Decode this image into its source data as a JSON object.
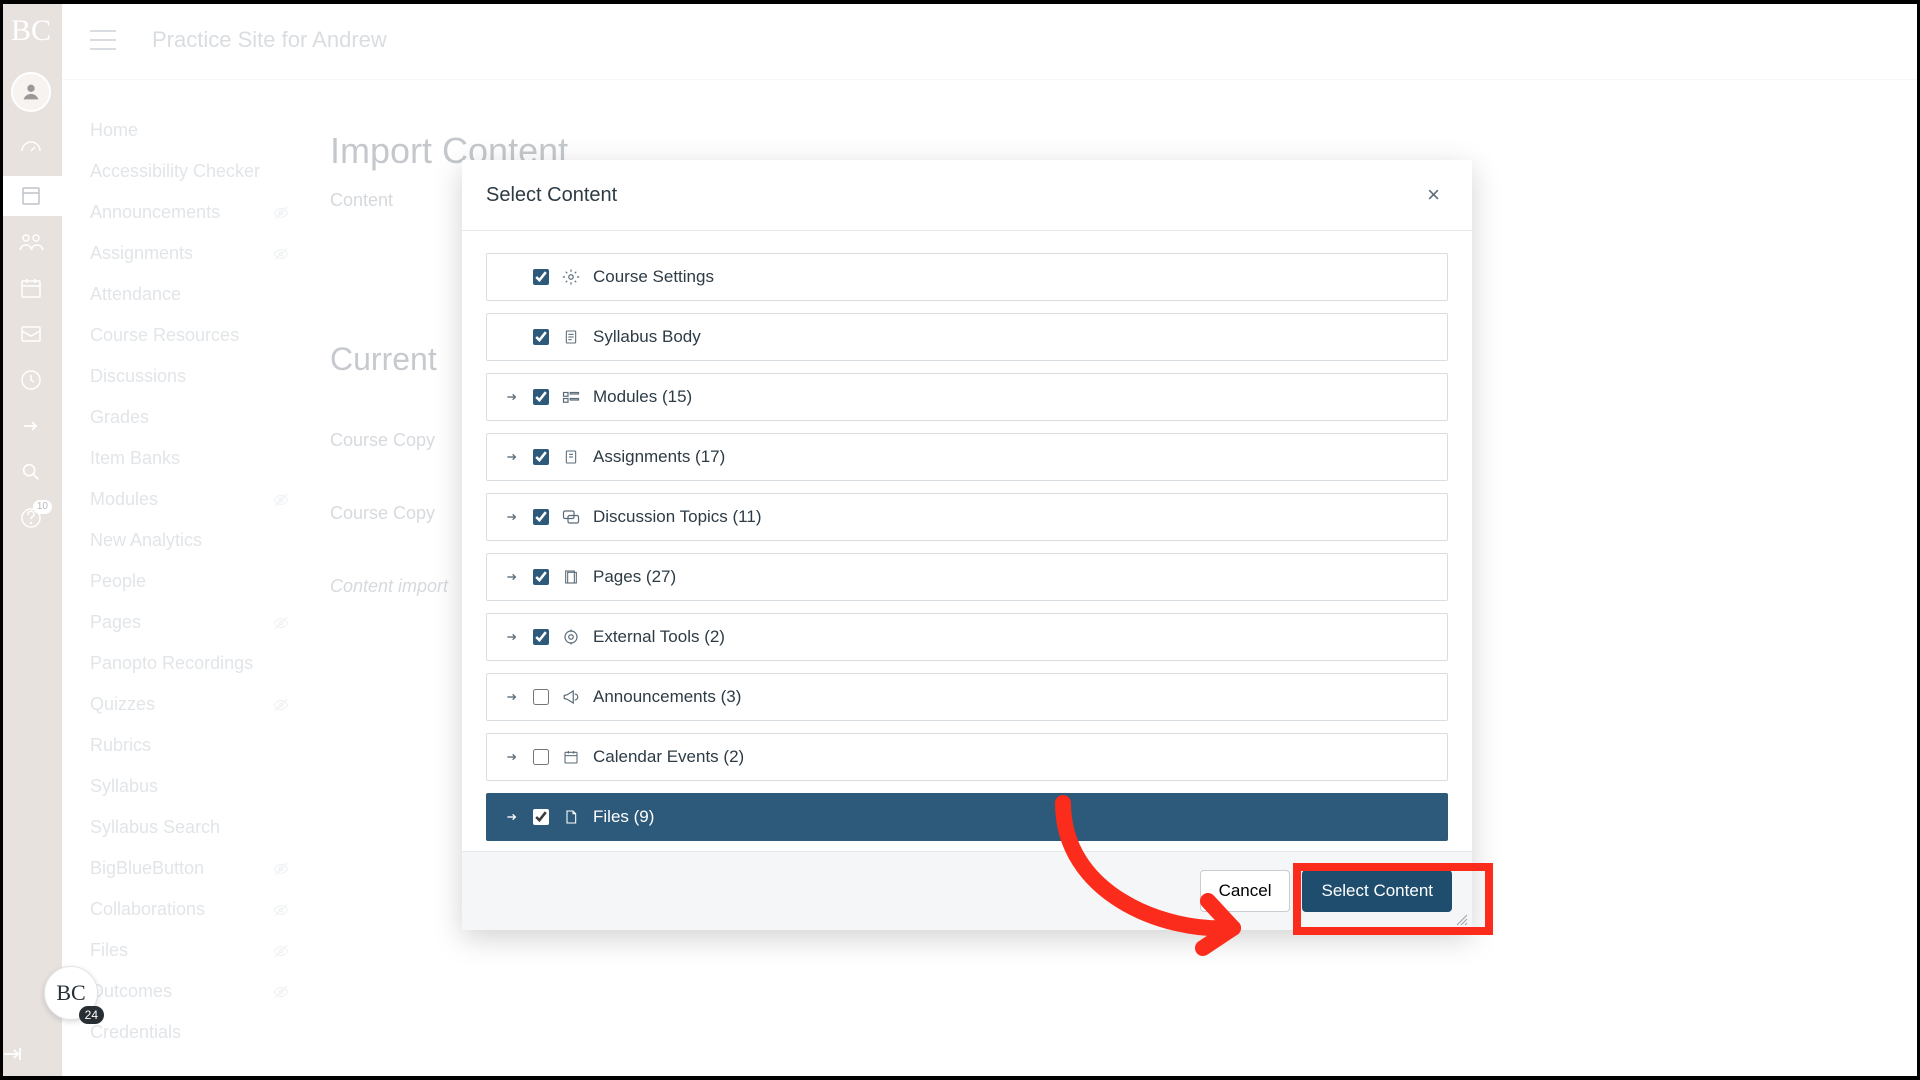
{
  "rail": {
    "logo": "BC",
    "help_badge": "10"
  },
  "topbar": {
    "breadcrumb": "Practice Site for Andrew"
  },
  "coursenav": [
    {
      "label": "Home",
      "hidden": false
    },
    {
      "label": "Accessibility Checker",
      "hidden": false
    },
    {
      "label": "Announcements",
      "hidden": true
    },
    {
      "label": "Assignments",
      "hidden": true
    },
    {
      "label": "Attendance",
      "hidden": false
    },
    {
      "label": "Course Resources",
      "hidden": false
    },
    {
      "label": "Discussions",
      "hidden": false
    },
    {
      "label": "Grades",
      "hidden": false
    },
    {
      "label": "Item Banks",
      "hidden": false
    },
    {
      "label": "Modules",
      "hidden": true
    },
    {
      "label": "New Analytics",
      "hidden": false
    },
    {
      "label": "People",
      "hidden": false
    },
    {
      "label": "Pages",
      "hidden": true
    },
    {
      "label": "Panopto Recordings",
      "hidden": false
    },
    {
      "label": "Quizzes",
      "hidden": true
    },
    {
      "label": "Rubrics",
      "hidden": false
    },
    {
      "label": "Syllabus",
      "hidden": false
    },
    {
      "label": "Syllabus Search",
      "hidden": false
    },
    {
      "label": "BigBlueButton",
      "hidden": true
    },
    {
      "label": "Collaborations",
      "hidden": true
    },
    {
      "label": "Files",
      "hidden": true
    },
    {
      "label": "Outcomes",
      "hidden": true
    },
    {
      "label": "Credentials",
      "hidden": false
    }
  ],
  "mainbg": {
    "h1": "Import Content",
    "lbl_content": "Content",
    "h2": "Current",
    "row1": "Course Copy",
    "row2": "Course Copy",
    "row3": "Content import"
  },
  "modal": {
    "title": "Select Content",
    "items": [
      {
        "expandable": false,
        "checked": true,
        "icon": "gear",
        "label": "Course Settings"
      },
      {
        "expandable": false,
        "checked": true,
        "icon": "doc",
        "label": "Syllabus Body"
      },
      {
        "expandable": true,
        "checked": true,
        "icon": "module",
        "label": "Modules (15)"
      },
      {
        "expandable": true,
        "checked": true,
        "icon": "assign",
        "label": "Assignments (17)"
      },
      {
        "expandable": true,
        "checked": true,
        "icon": "discuss",
        "label": "Discussion Topics (11)"
      },
      {
        "expandable": true,
        "checked": true,
        "icon": "page",
        "label": "Pages (27)"
      },
      {
        "expandable": true,
        "checked": true,
        "icon": "tool",
        "label": "External Tools (2)"
      },
      {
        "expandable": true,
        "checked": false,
        "icon": "announce",
        "label": "Announcements (3)"
      },
      {
        "expandable": true,
        "checked": false,
        "icon": "calendar",
        "label": "Calendar Events (2)"
      },
      {
        "expandable": true,
        "checked": true,
        "icon": "file",
        "label": "Files (9)",
        "selected": true
      }
    ],
    "cancel": "Cancel",
    "submit": "Select Content"
  },
  "float": {
    "text": "BC",
    "count": "24"
  }
}
